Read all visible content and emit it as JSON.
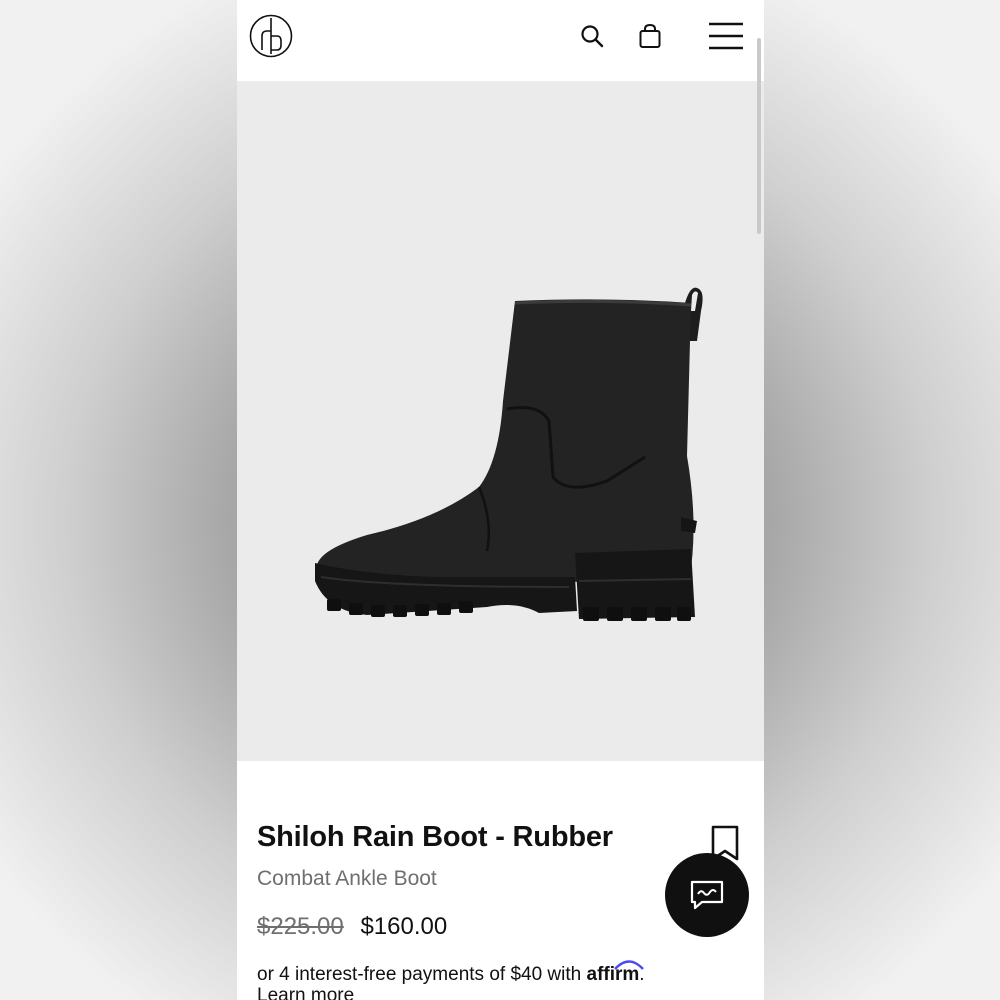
{
  "header": {
    "logo_icon": "rb-monogram-logo",
    "search_icon": "search-icon",
    "bag_icon": "shopping-bag-icon",
    "menu_icon": "hamburger-menu-icon"
  },
  "product": {
    "image": "black-rain-boot",
    "title": "Shiloh Rain Boot - Rubber",
    "subtitle": "Combat Ankle Boot",
    "price_original": "$225.00",
    "price_sale": "$160.00",
    "installments_text": "or 4 interest-free payments of $40 with ",
    "affirm_brand": "affirm",
    "affirm_suffix": ".",
    "learn_more": "Learn more",
    "bookmark_icon": "bookmark-icon"
  },
  "chat": {
    "icon": "chat-icon"
  },
  "colors": {
    "page_bg": "#ffffff",
    "image_bg": "#ebebeb",
    "text_primary": "#111111",
    "text_secondary": "#6f6f6f",
    "chat_bg": "#101010",
    "affirm_arc": "#4a4af4"
  }
}
